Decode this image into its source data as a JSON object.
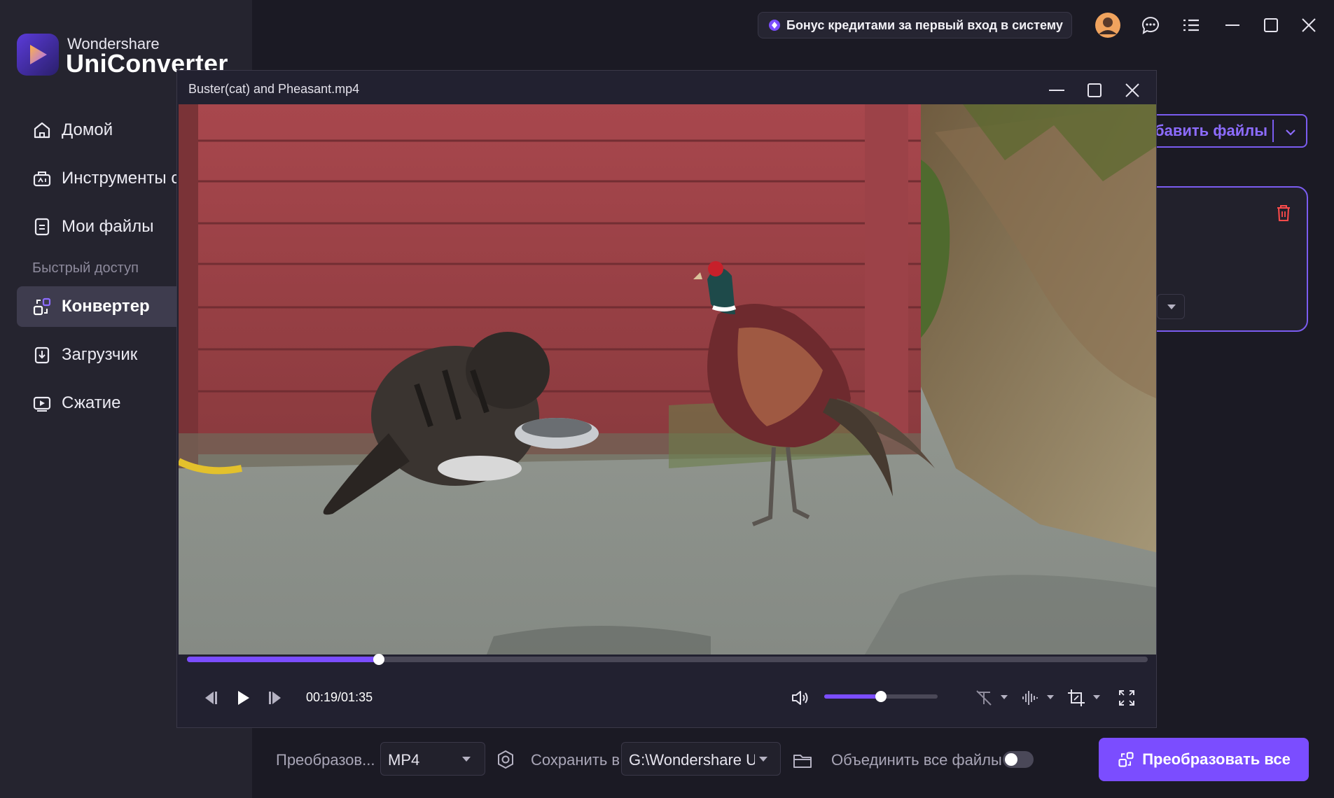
{
  "app": {
    "brand_top": "Wondershare",
    "brand_main": "UniConverter",
    "accent_color": "#7b4dff"
  },
  "sidebar": {
    "items": [
      {
        "label": "Домой",
        "icon": "home-icon"
      },
      {
        "label": "Инструменты с",
        "icon": "toolbox-icon"
      },
      {
        "label": "Мои файлы",
        "icon": "file-icon"
      }
    ],
    "section_label": "Быстрый доступ",
    "quick": [
      {
        "label": "Конвертер",
        "icon": "converter-icon",
        "active": true
      },
      {
        "label": "Загрузчик",
        "icon": "downloader-icon"
      },
      {
        "label": "Сжатие",
        "icon": "compress-icon"
      }
    ]
  },
  "topbar": {
    "bonus_label": "Бонус кредитами за первый вход в систему"
  },
  "main": {
    "add_files_label": "бавить файлы"
  },
  "player": {
    "title": "Buster(cat) and Pheasant.mp4",
    "time": "00:19/01:35",
    "progress": 0.2,
    "volume": 0.5
  },
  "bottom": {
    "convert_label": "Преобразов...",
    "format_value": "MP4",
    "save_label": "Сохранить в",
    "save_path": "G:\\Wondershare Ur",
    "merge_label": "Объединить все файлы",
    "merge_on": false,
    "convert_all_label": "Преобразовать все"
  }
}
